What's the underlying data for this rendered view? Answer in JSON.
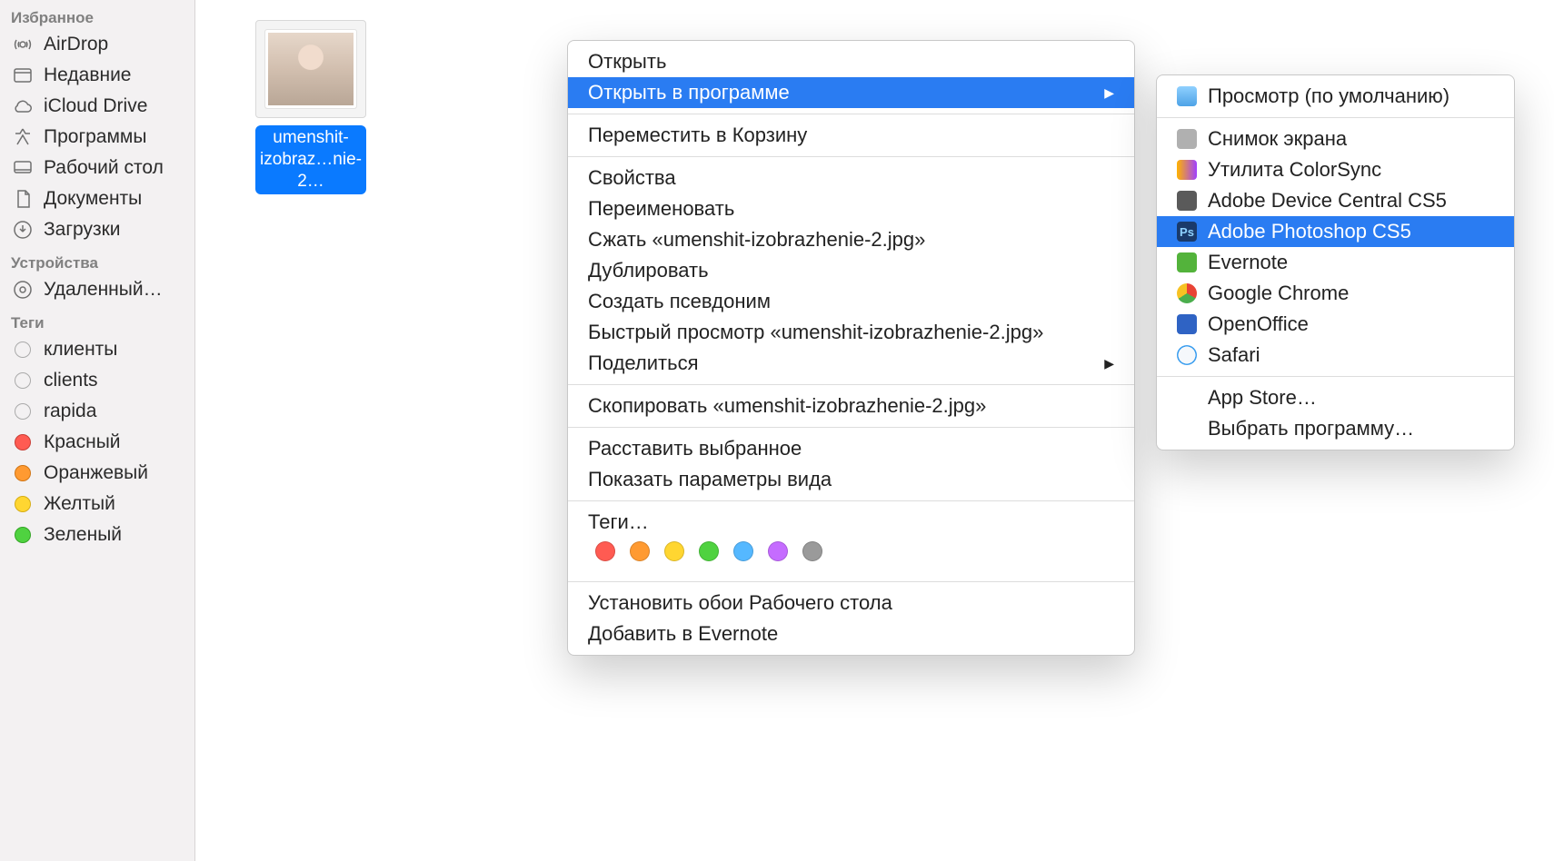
{
  "sidebar": {
    "sections": [
      {
        "header": "Избранное",
        "items": [
          {
            "id": "airdrop",
            "label": "AirDrop",
            "icon": "airdrop"
          },
          {
            "id": "recents",
            "label": "Недавние",
            "icon": "recents"
          },
          {
            "id": "icloud",
            "label": "iCloud Drive",
            "icon": "icloud"
          },
          {
            "id": "apps",
            "label": "Программы",
            "icon": "apps"
          },
          {
            "id": "desktop",
            "label": "Рабочий стол",
            "icon": "desktop"
          },
          {
            "id": "documents",
            "label": "Документы",
            "icon": "documents"
          },
          {
            "id": "downloads",
            "label": "Загрузки",
            "icon": "downloads"
          }
        ]
      },
      {
        "header": "Устройства",
        "items": [
          {
            "id": "remote",
            "label": "Удаленный…",
            "icon": "disc"
          }
        ]
      },
      {
        "header": "Теги",
        "items": [
          {
            "id": "tag-klienty",
            "label": "клиенты",
            "icon": "tag-empty"
          },
          {
            "id": "tag-clients",
            "label": "clients",
            "icon": "tag-empty"
          },
          {
            "id": "tag-rapida",
            "label": "rapida",
            "icon": "tag-empty"
          },
          {
            "id": "tag-red",
            "label": "Красный",
            "icon": "tag-red"
          },
          {
            "id": "tag-orange",
            "label": "Оранжевый",
            "icon": "tag-orange"
          },
          {
            "id": "tag-yellow",
            "label": "Желтый",
            "icon": "tag-yellow"
          },
          {
            "id": "tag-green",
            "label": "Зеленый",
            "icon": "tag-green"
          }
        ]
      }
    ]
  },
  "file": {
    "name_line1": "umenshit-",
    "name_line2": "izobraz…nie-2…"
  },
  "context_menu": {
    "items": [
      {
        "label": "Открыть"
      },
      {
        "label": "Открыть в программе",
        "submenu": true,
        "highlight": true
      },
      {
        "sep": true
      },
      {
        "label": "Переместить в Корзину"
      },
      {
        "sep": true
      },
      {
        "label": "Свойства"
      },
      {
        "label": "Переименовать"
      },
      {
        "label": "Сжать «umenshit-izobrazhenie-2.jpg»"
      },
      {
        "label": "Дублировать"
      },
      {
        "label": "Создать псевдоним"
      },
      {
        "label": "Быстрый просмотр «umenshit-izobrazhenie-2.jpg»"
      },
      {
        "label": "Поделиться",
        "submenu": true
      },
      {
        "sep": true
      },
      {
        "label": "Скопировать «umenshit-izobrazhenie-2.jpg»"
      },
      {
        "sep": true
      },
      {
        "label": "Расставить выбранное"
      },
      {
        "label": "Показать параметры вида"
      },
      {
        "sep": true
      },
      {
        "label": "Теги…",
        "tagrow": true
      },
      {
        "sep": true
      },
      {
        "label": "Установить обои Рабочего стола"
      },
      {
        "label": "Добавить в Evernote"
      }
    ],
    "tag_colors": [
      "#ff5b52",
      "#ff9a31",
      "#ffd631",
      "#4fd240",
      "#55b8ff",
      "#c56cff",
      "#9a9a9a"
    ]
  },
  "submenu": {
    "items": [
      {
        "label": "Просмотр (по умолчанию)",
        "icon": "preview"
      },
      {
        "sep": true
      },
      {
        "label": "Снимок экрана",
        "icon": "screenshot"
      },
      {
        "label": "Утилита ColorSync",
        "icon": "colorsync"
      },
      {
        "label": "Adobe Device Central CS5",
        "icon": "devicecentral"
      },
      {
        "label": "Adobe Photoshop CS5",
        "icon": "photoshop",
        "highlight": true
      },
      {
        "label": "Evernote",
        "icon": "evernote"
      },
      {
        "label": "Google Chrome",
        "icon": "chrome"
      },
      {
        "label": "OpenOffice",
        "icon": "openoffice"
      },
      {
        "label": "Safari",
        "icon": "safari"
      },
      {
        "sep": true
      },
      {
        "label": "App Store…"
      },
      {
        "label": "Выбрать программу…"
      }
    ]
  }
}
